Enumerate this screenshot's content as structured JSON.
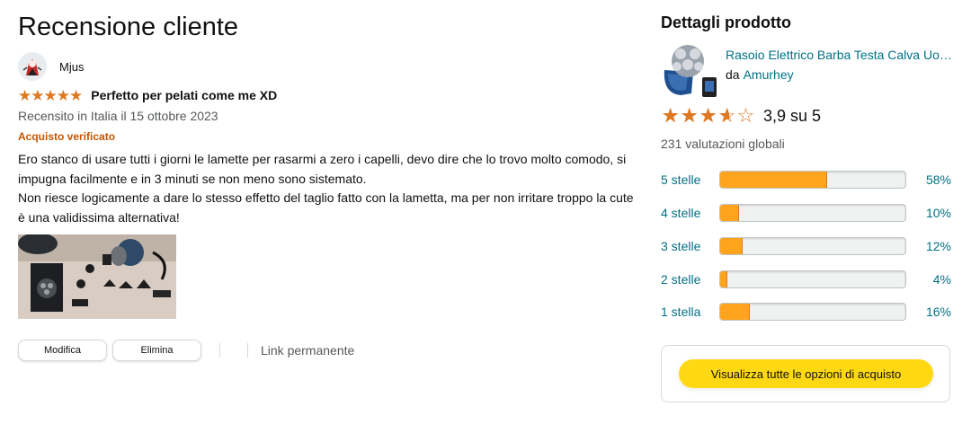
{
  "review": {
    "page_title": "Recensione cliente",
    "reviewer_name": "Mjus",
    "rating": 5,
    "star_glyph": "★",
    "title": "Perfetto per pelati come me XD",
    "date_line": "Recensito in Italia il 15 ottobre 2023",
    "verified": "Acquisto verificato",
    "body_p1": "Ero stanco di usare tutti i giorni le lamette per rasarmi a zero i capelli, devo dire che lo trovo molto comodo, si impugna facilmente e in 3 minuti se non meno sono sistemato.",
    "body_p2": "Non riesce logicamente a dare lo stesso effetto del taglio fatto con la lametta, ma per non irritare troppo la cute è una validissima alternativa!",
    "actions": {
      "edit_label": "Modifica",
      "delete_label": "Elimina",
      "permalink_label": "Link permanente"
    }
  },
  "product": {
    "heading": "Dettagli prodotto",
    "name": "Rasoio Elettrico Barba Testa Calva Uomo",
    "by_prefix": "da",
    "brand": "Amurhey",
    "average_rating": 3.9,
    "average_text": "3,9 su 5",
    "global_ratings": "231 valutazioni globali",
    "histogram": [
      {
        "label": "5 stelle",
        "percent": 58,
        "percent_text": "58%"
      },
      {
        "label": "4 stelle",
        "percent": 10,
        "percent_text": "10%"
      },
      {
        "label": "3 stelle",
        "percent": 12,
        "percent_text": "12%"
      },
      {
        "label": "2 stelle",
        "percent": 4,
        "percent_text": "4%"
      },
      {
        "label": "1 stella",
        "percent": 16,
        "percent_text": "16%"
      }
    ],
    "buy_button_label": "Visualizza tutte le opzioni di acquisto"
  },
  "colors": {
    "star": "#de7921",
    "bar_fill": "#ffa41c",
    "link": "#007185",
    "verified": "#c45500",
    "buy_button": "#ffd814"
  }
}
